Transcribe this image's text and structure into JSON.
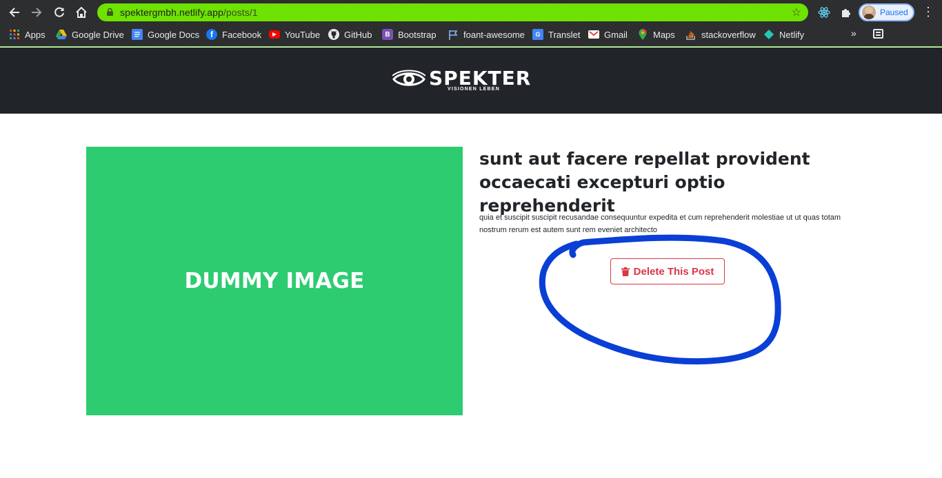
{
  "browser": {
    "url_host": "spektergmbh.netlify.app",
    "url_path": "/posts/1",
    "profile_status": "Paused",
    "accent_color": "#6ee200"
  },
  "bookmarks": [
    {
      "label": "Apps",
      "icon": "apps-grid-icon"
    },
    {
      "label": "Google Drive",
      "icon": "google-drive-icon"
    },
    {
      "label": "Google Docs",
      "icon": "google-docs-icon"
    },
    {
      "label": "Facebook",
      "icon": "facebook-icon"
    },
    {
      "label": "YouTube",
      "icon": "youtube-icon"
    },
    {
      "label": "GitHub",
      "icon": "github-icon"
    },
    {
      "label": "Bootstrap",
      "icon": "bootstrap-icon"
    },
    {
      "label": "foant-awesome",
      "icon": "flag-icon"
    },
    {
      "label": "Translet",
      "icon": "google-translate-icon"
    },
    {
      "label": "Gmail",
      "icon": "gmail-icon"
    },
    {
      "label": "Maps",
      "icon": "maps-icon"
    },
    {
      "label": "stackoverflow",
      "icon": "stackoverflow-icon"
    },
    {
      "label": "Netlify",
      "icon": "netlify-icon"
    }
  ],
  "site": {
    "logo_text": "SPEKTER",
    "logo_tagline": "VISIONEN LEBEN",
    "header_color": "#212529"
  },
  "post": {
    "image_text": "DUMMY IMAGE",
    "image_color": "#2ecc71",
    "title": "sunt aut facere repellat provident occaecati excepturi optio reprehenderit",
    "body": "quia et suscipit suscipit recusandae consequuntur expedita et cum reprehenderit molestiae ut ut quas totam nostrum rerum est autem sunt rem eveniet architecto",
    "delete_label": "Delete This Post",
    "delete_color": "#dc3545"
  },
  "annotation": {
    "color": "#0a3fd6"
  }
}
